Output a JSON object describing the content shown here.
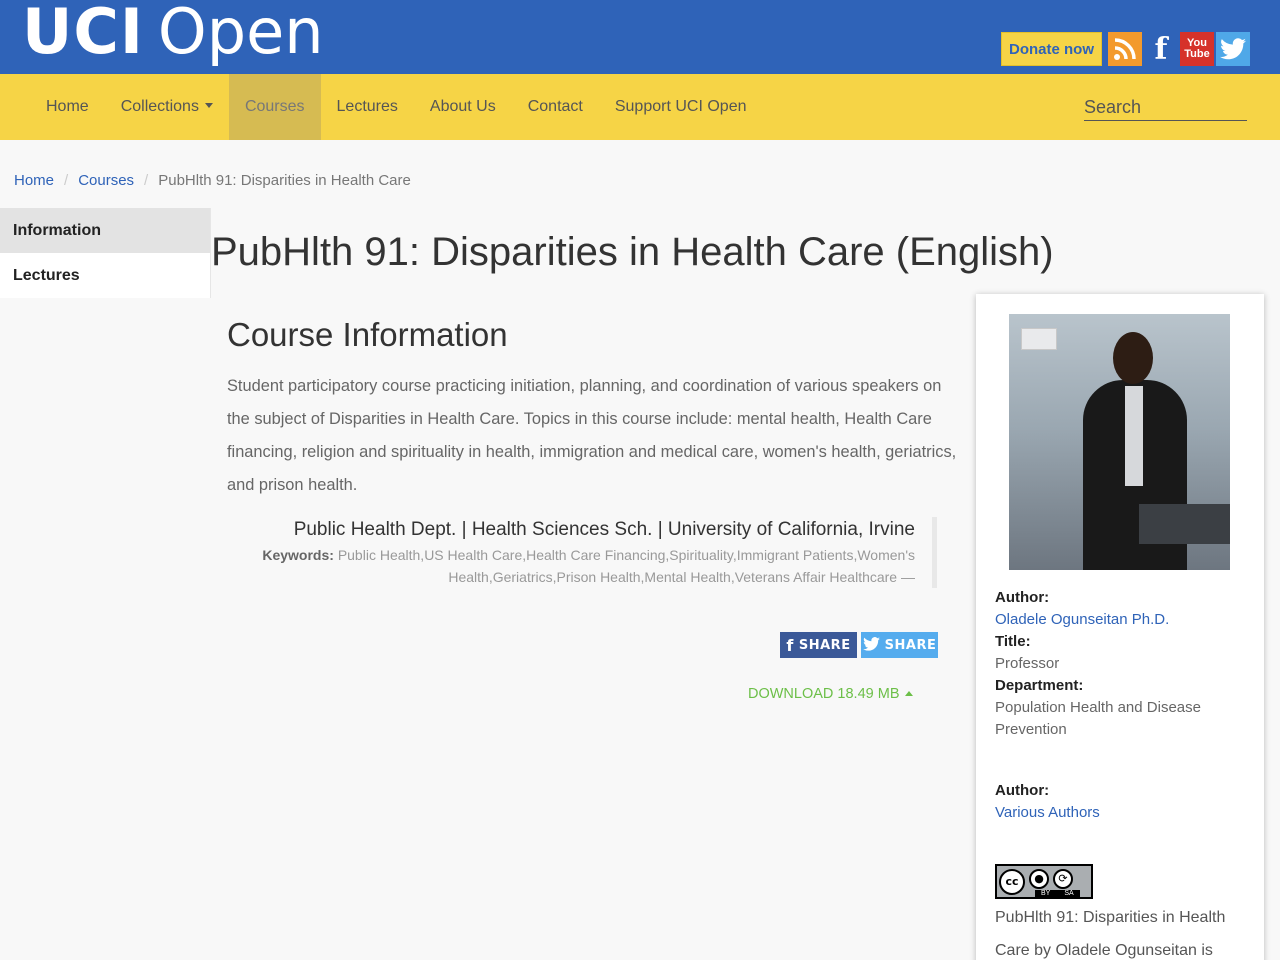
{
  "banner": {
    "logo_primary": "UCI",
    "logo_secondary": "Open",
    "donate_label": "Donate now",
    "social_icons": [
      "rss-icon",
      "facebook-icon",
      "youtube-icon",
      "twitter-icon"
    ],
    "youtube_top": "You",
    "youtube_bottom": "Tube",
    "facebook_glyph": "f"
  },
  "nav": {
    "items": [
      "Home",
      "Collections",
      "Courses",
      "Lectures",
      "About Us",
      "Contact",
      "Support UCI Open"
    ],
    "active": "Courses",
    "search_placeholder": "Search"
  },
  "breadcrumb": {
    "items": [
      "Home",
      "Courses",
      "PubHlth 91: Disparities in Health Care"
    ],
    "separator": "/"
  },
  "sidebar": {
    "tabs": [
      "Information",
      "Lectures"
    ],
    "active": "Information"
  },
  "main": {
    "title": "PubHlth 91: Disparities in Health Care (English)",
    "section_heading": "Course Information",
    "description": "Student participatory course practicing initiation, planning, and coordination of various speakers on the subject of Disparities in Health Care. Topics in this course include: mental health, Health Care financing, religion and spirituality in health, immigration and medical care, women's health, geriatrics, and prison health.",
    "department_line": "Public Health Dept. | Health Sciences Sch. | University of California, Irvine",
    "keywords_label": "Keywords:",
    "keywords": "Public Health,US Health Care,Health Care Financing,Spirituality,Immigrant Patients,Women's Health,Geriatrics,Prison Health,Mental Health,Veterans Affair Healthcare —",
    "share_facebook": "SHARE",
    "share_twitter": "SHARE",
    "download_label": "DOWNLOAD 18.49 MB"
  },
  "author_card": {
    "author_label": "Author:",
    "author_name": "Oladele Ogunseitan Ph.D.",
    "title_label": "Title:",
    "title_value": "Professor",
    "department_label": "Department:",
    "department_value": "Population Health and Disease Prevention",
    "author2_label": "Author:",
    "author2_name": "Various Authors",
    "cc_main": "cc",
    "cc_by": "BY",
    "cc_sa": "SA",
    "license_text": "PubHlth 91: Disparities in Health Care by Oladele Ogunseitan is"
  },
  "colors": {
    "banner": "#2f63b8",
    "navbar": "#f6d446",
    "nav_active": "#d6bb52",
    "link": "#2f63b8",
    "download": "#6cbf48",
    "facebook": "#3b5998",
    "twitter": "#55acee"
  }
}
